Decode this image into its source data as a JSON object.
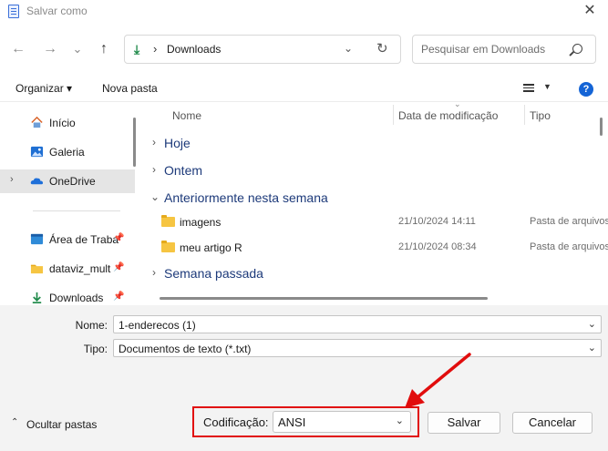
{
  "window": {
    "title": "Salvar como",
    "close_glyph": "✕"
  },
  "nav": {
    "back_glyph": "←",
    "forward_glyph": "→",
    "recent_glyph": "⌄",
    "up_glyph": "↑"
  },
  "address": {
    "separator": "›",
    "location": "Downloads",
    "dropdown_glyph": "⌄",
    "refresh_glyph": "↻"
  },
  "search": {
    "placeholder": "Pesquisar em Downloads"
  },
  "toolbar": {
    "organize_label": "Organizar ▾",
    "new_folder_label": "Nova pasta",
    "view_dd_glyph": "▼",
    "help_label": "?"
  },
  "sidebar": {
    "items": [
      {
        "label": "Início",
        "icon": "home-icon"
      },
      {
        "label": "Galeria",
        "icon": "gallery-icon"
      },
      {
        "label": "OneDrive",
        "icon": "onedrive-icon",
        "chevron": "›"
      },
      {
        "label": "Área de Traba",
        "icon": "desktop-icon",
        "pin": "📌"
      },
      {
        "label": "dataviz_mult",
        "icon": "folder-icon",
        "pin": "📌"
      },
      {
        "label": "Downloads",
        "icon": "downloads-icon",
        "pin": "📌"
      }
    ]
  },
  "columns": {
    "name": "Nome",
    "date": "Data de modificação",
    "type": "Tipo",
    "sort_glyph": "⌄"
  },
  "groups": [
    {
      "label": "Hoje",
      "chevron": "›"
    },
    {
      "label": "Ontem",
      "chevron": "›"
    },
    {
      "label": "Anteriormente nesta semana",
      "chevron": "⌄"
    },
    {
      "label": "Semana passada",
      "chevron": "›"
    }
  ],
  "rows": [
    {
      "name": "imagens",
      "date": "21/10/2024 14:11",
      "type": "Pasta de arquivos"
    },
    {
      "name": "meu artigo R",
      "date": "21/10/2024 08:34",
      "type": "Pasta de arquivos"
    }
  ],
  "form": {
    "name_label": "Nome:",
    "name_value": "1-enderecos (1)",
    "type_label": "Tipo:",
    "type_value": "Documentos de texto (*.txt)",
    "dropdown_glyph": "⌄"
  },
  "footer": {
    "hide_chevron": "⌃",
    "hide_label": "Ocultar pastas",
    "encoding_label": "Codificação:",
    "encoding_value": "ANSI",
    "save_label": "Salvar",
    "cancel_label": "Cancelar"
  },
  "colors": {
    "highlight_box": "#e10d0d",
    "arrow": "#e10d0d",
    "accent": "#1464d6"
  }
}
